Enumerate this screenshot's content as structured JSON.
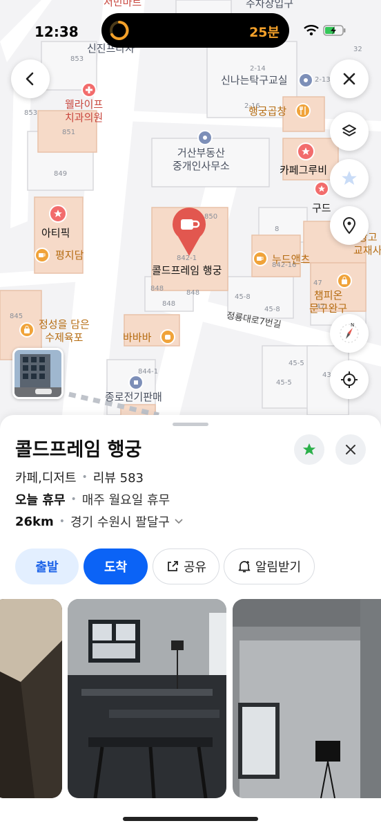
{
  "status_bar": {
    "time": "12:38",
    "island_text": "25분"
  },
  "map": {
    "labels_top": [
      "서민마트",
      "주차장입구"
    ],
    "pois": {
      "clinic_line1": "웰라이프",
      "clinic_line2": "치과의원",
      "realty_line1": "거산부동산",
      "realty_line2": "중개인사무소",
      "pingpong": "신나는탁구교실",
      "gopchang": "행궁곱창",
      "cafe_groove": "카페그루비",
      "gude": "구드",
      "atipik": "아티픽",
      "pyeongjidam": "평지담",
      "nude": "누드앤츠",
      "champion_line1": "챔피온",
      "champion_line2": "문구완구",
      "sujeyukpo_line1": "정성을 담은",
      "sujeyukpo_line2": "수제육포",
      "bababa": "바바바",
      "jongro": "종로전기판매",
      "sinjin": "신진프라자",
      "gwanggo_line1": "광고",
      "gwanggo_line2": "교재사",
      "selected_place": "콜드프레임 행궁"
    },
    "road_name": "정룡대로7번길",
    "numbers": [
      "853",
      "851",
      "849",
      "853",
      "2-14",
      "2-13",
      "2-16",
      "32",
      "8",
      "842-16",
      "47",
      "47",
      "45-8",
      "45-8",
      "848",
      "848",
      "848",
      "844-1",
      "45-5",
      "45-5",
      "43",
      "845",
      "850",
      "842-1"
    ],
    "icons": {
      "back": "back-chevron-icon",
      "close": "close-icon",
      "layers": "layers-icon",
      "favorite": "star-icon",
      "place": "location-pin-icon",
      "compass": "compass-icon",
      "locate": "crosshair-icon"
    }
  },
  "place": {
    "name": "콜드프레임 행궁",
    "category": "카페,디저트",
    "review_label": "리뷰 583",
    "hours_status": "오늘 휴무",
    "hours_detail": "매주 월요일 휴무",
    "distance": "26km",
    "address": "경기 수원시 팔달구"
  },
  "actions": {
    "depart": "출발",
    "arrive": "도착",
    "share": "공유",
    "notify": "알림받기"
  },
  "colors": {
    "primary_blue": "#0b63f6",
    "light_blue": "#e3efff",
    "favorite_green": "#2bb04a",
    "pin_red": "#e2574f",
    "island_orange": "#f4a12a"
  }
}
